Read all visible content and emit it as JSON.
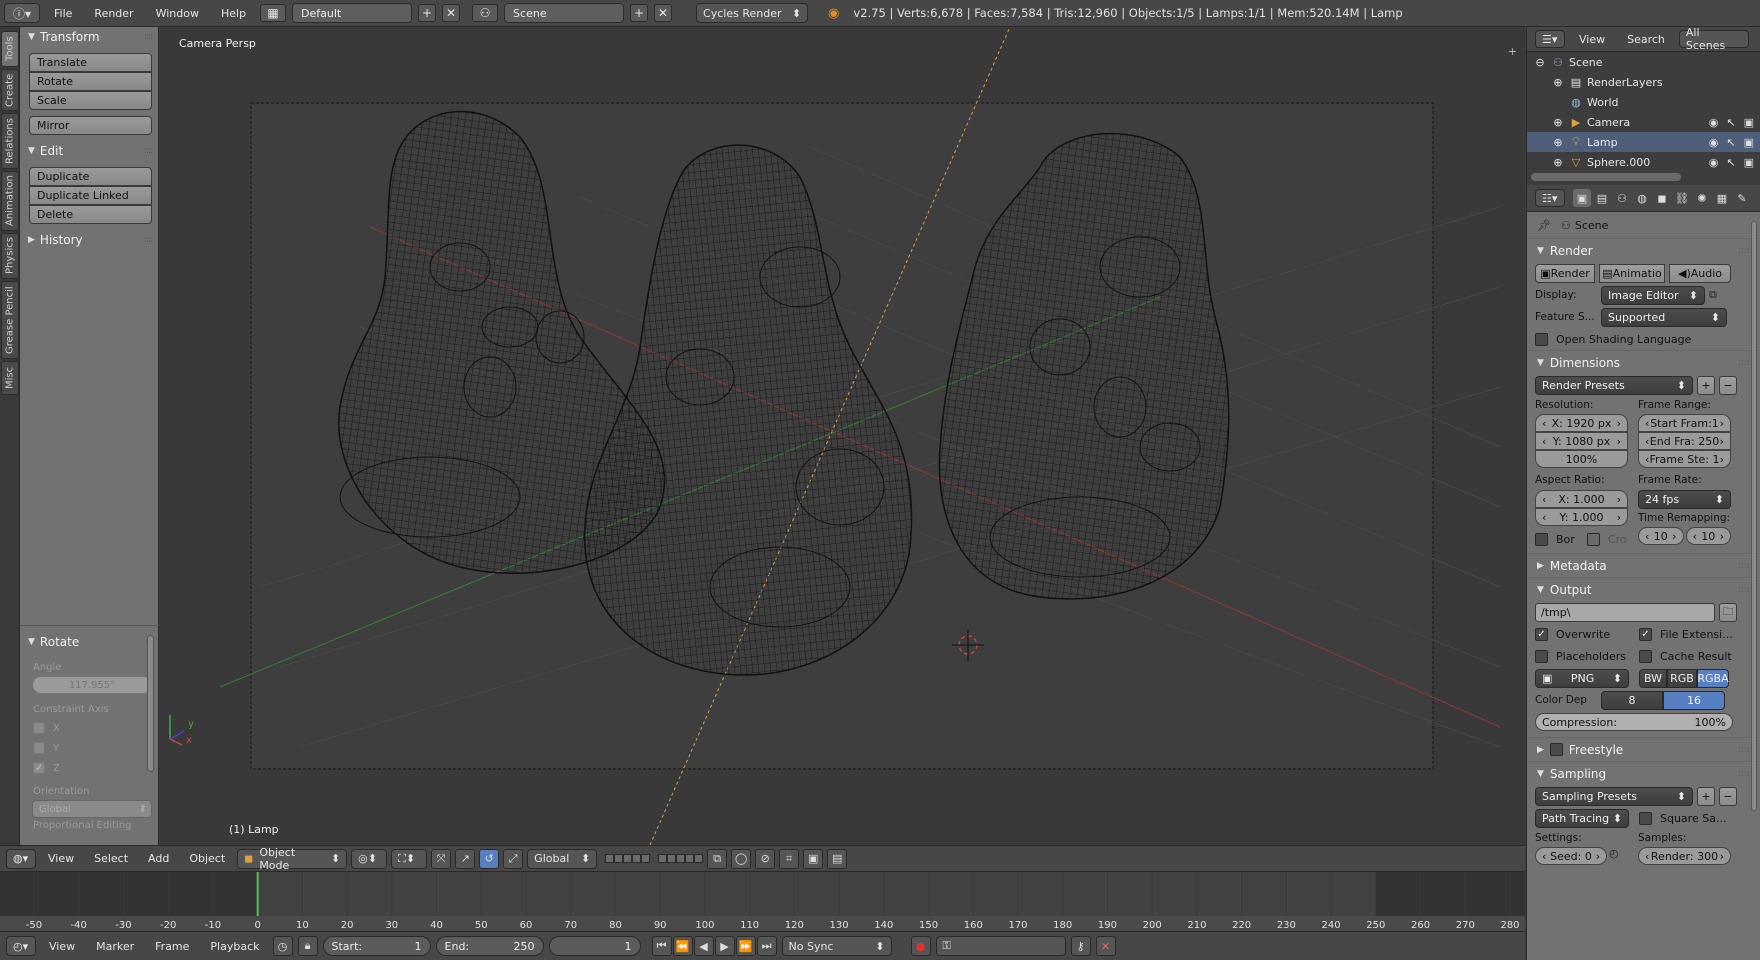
{
  "topbar": {
    "info_icon": "info-icon",
    "menus": [
      "File",
      "Render",
      "Window",
      "Help"
    ],
    "screen_layout": "Default",
    "scene": "Scene",
    "render_engine": "Cycles Render",
    "stats": "v2.75 | Verts:6,678 | Faces:7,584 | Tris:12,960 | Objects:1/5 | Lamps:1/1 | Mem:520.14M | Lamp"
  },
  "left_tabs": [
    "Tools",
    "Create",
    "Relations",
    "Animation",
    "Physics",
    "Grease Pencil",
    "Misc"
  ],
  "toolshelf": {
    "transform": {
      "title": "Transform",
      "buttons": [
        "Translate",
        "Rotate",
        "Scale"
      ],
      "mirror": "Mirror"
    },
    "edit": {
      "title": "Edit",
      "buttons": [
        "Duplicate",
        "Duplicate Linked",
        "Delete"
      ]
    },
    "history": {
      "title": "History"
    }
  },
  "operator": {
    "title": "Rotate",
    "angle_label": "Angle",
    "angle_value": "117.955°",
    "constraint_label": "Constraint Axis",
    "axes": [
      {
        "label": "X",
        "checked": false
      },
      {
        "label": "Y",
        "checked": false
      },
      {
        "label": "Z",
        "checked": true
      }
    ],
    "orientation_label": "Orientation",
    "orientation_value": "Global",
    "proportional_label": "Proportional Editing"
  },
  "viewport": {
    "title": "Camera Persp",
    "active_object": "(1) Lamp"
  },
  "viewport_header": {
    "menus": [
      "View",
      "Select",
      "Add",
      "Object"
    ],
    "mode": "Object Mode",
    "orientation": "Global"
  },
  "timeline": {
    "ticks": [
      "-50",
      "-40",
      "-30",
      "-20",
      "-10",
      "0",
      "10",
      "20",
      "30",
      "40",
      "50",
      "60",
      "70",
      "80",
      "90",
      "100",
      "110",
      "120",
      "130",
      "140",
      "150",
      "160",
      "170",
      "180",
      "190",
      "200",
      "210",
      "220",
      "230",
      "240",
      "250",
      "260",
      "270",
      "280"
    ],
    "current_frame": 0
  },
  "timeline_footer": {
    "menus": [
      "View",
      "Marker",
      "Frame",
      "Playback"
    ],
    "start_label": "Start:",
    "start_value": "1",
    "end_label": "End:",
    "end_value": "250",
    "current_value": "1",
    "sync": "No Sync"
  },
  "outliner": {
    "menus": [
      "View",
      "Search"
    ],
    "filter": "All Scenes",
    "items": [
      {
        "name": "Scene",
        "icon": "scene-icon",
        "depth": 0
      },
      {
        "name": "RenderLayers",
        "icon": "renderlayers-icon",
        "depth": 1
      },
      {
        "name": "World",
        "icon": "world-icon",
        "depth": 1
      },
      {
        "name": "Camera",
        "icon": "camera-icon",
        "depth": 1
      },
      {
        "name": "Lamp",
        "icon": "lamp-icon",
        "depth": 1
      },
      {
        "name": "Sphere.000",
        "icon": "mesh-icon",
        "depth": 1
      }
    ]
  },
  "properties": {
    "scene_label": "Scene",
    "render": {
      "title": "Render",
      "tabs": [
        "Render",
        "Animatio",
        "Audio"
      ],
      "display_label": "Display:",
      "display_value": "Image Editor",
      "feature_label": "Feature S...",
      "feature_value": "Supported",
      "osl_label": "Open Shading Language"
    },
    "dimensions": {
      "title": "Dimensions",
      "presets": "Render Presets",
      "resolution_label": "Resolution:",
      "res_x": "X:  1920 px",
      "res_y": "Y:  1080 px",
      "res_pct": "100%",
      "frame_range_label": "Frame Range:",
      "start_frame": "Start Fram:1",
      "end_frame": "End Fra: 250",
      "frame_step": "Frame Ste: 1",
      "aspect_label": "Aspect Ratio:",
      "aspect_x": "X:     1.000",
      "aspect_y": "Y:     1.000",
      "frame_rate_label": "Frame Rate:",
      "frame_rate": "24 fps",
      "time_remap_label": "Time Remapping:",
      "remap_old": "10",
      "remap_new": "10",
      "border_label": "Bor",
      "crop_label": "Cro"
    },
    "metadata": {
      "title": "Metadata"
    },
    "output": {
      "title": "Output",
      "path": "/tmp\\",
      "overwrite": "Overwrite",
      "file_ext": "File Extensi...",
      "placeholders": "Placeholders",
      "cache_result": "Cache Result",
      "format": "PNG",
      "color_modes": [
        "BW",
        "RGB",
        "RGBA"
      ],
      "color_depth_label": "Color Dep",
      "depths": [
        "8",
        "16"
      ],
      "compression": "Compression:",
      "compression_value": "100%"
    },
    "freestyle": {
      "title": "Freestyle"
    },
    "sampling": {
      "title": "Sampling",
      "presets": "Sampling Presets",
      "integrator": "Path Tracing",
      "square_label": "Square Sa...",
      "settings_label": "Settings:",
      "samples_label": "Samples:",
      "seed": "Seed:   0",
      "render_samples": "Render: 300"
    }
  }
}
